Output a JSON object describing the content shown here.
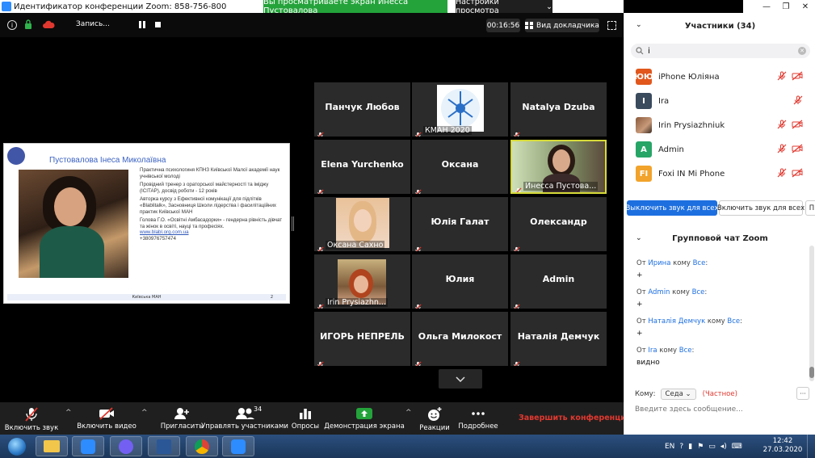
{
  "window": {
    "title": "Идентификатор конференции Zoom: 858-756-800",
    "viewing_banner": "Вы просматриваете экран Инесса Пустовалова",
    "view_settings": "Настройки просмотра"
  },
  "status_bar": {
    "recording_label": "Запись...",
    "timer": "00:16:56",
    "speaker_view": "Вид докладчика"
  },
  "shared_slide": {
    "title": "Пустовалова Інеса Миколаївна",
    "paragraphs": [
      "Практична психологиня КПНЗ Київської Малої академії наук учнівської молоді",
      "Провідний тренер з ораторської майстерності та іміджу (ІСІТАР), досвід роботи - 12 років",
      "Авторка курсу з Ефективної комунікації для підлітків «Blablitalk», Засновниця Школи лідерства і фасилітаційних практик Київської МАН",
      "Голова Г.О. «Освітні Амбасадорки» - гендерна рівність дівчат та жінок в освіті, науці та професіях."
    ],
    "link": "www.blabl.org.com.ua",
    "phone": "+380976757474",
    "footer": "Київська МАН",
    "page_number": "2"
  },
  "grid": {
    "tiles": [
      {
        "name": "Панчук Любов",
        "label": "",
        "kind": "name"
      },
      {
        "name": "",
        "label": "КМАН 2020",
        "kind": "logo"
      },
      {
        "name": "Natalya  Dzuba",
        "label": "",
        "kind": "name"
      },
      {
        "name": "Elena Yurchenko",
        "label": "",
        "kind": "name"
      },
      {
        "name": "Оксана",
        "label": "",
        "kind": "name"
      },
      {
        "name": "",
        "label": "Инесса Пустова...",
        "kind": "video"
      },
      {
        "name": "",
        "label": "Оксана Сахно",
        "kind": "photo"
      },
      {
        "name": "Юлія Галат",
        "label": "",
        "kind": "name"
      },
      {
        "name": "Олександр",
        "label": "",
        "kind": "name"
      },
      {
        "name": "",
        "label": "Irin Prysiazhn...",
        "kind": "photo"
      },
      {
        "name": "Юлия",
        "label": "",
        "kind": "name"
      },
      {
        "name": "Admin",
        "label": "",
        "kind": "name"
      },
      {
        "name": "ИГОРЬ НЕПРЕЛЬ",
        "label": "",
        "kind": "name"
      },
      {
        "name": "Ольга Милокост",
        "label": "",
        "kind": "name"
      },
      {
        "name": "Наталія Демчук",
        "label": "",
        "kind": "name"
      }
    ]
  },
  "toolbar": {
    "unmute": "Включить звук",
    "start_video": "Включить видео",
    "invite": "Пригласить",
    "manage_participants": "Управлять участниками",
    "participant_count": "34",
    "polls": "Опросы",
    "share_screen": "Демонстрация экрана",
    "reactions": "Реакции",
    "more": "Подробнее",
    "end": "Завершить конференцию"
  },
  "participants_panel": {
    "title": "Участники (34)",
    "search_value": "i",
    "participants": [
      {
        "initials": "ЮЮ",
        "name": "iPhone Юліяна",
        "color": "#e1571c"
      },
      {
        "initials": "I",
        "name": "Ira",
        "color": "#3b4b5e"
      },
      {
        "initials": "",
        "name": "Irin Prysiazhniuk",
        "color": "#8a5a3c"
      },
      {
        "initials": "A",
        "name": "Admin",
        "color": "#27a567"
      },
      {
        "initials": "FI",
        "name": "Foxi IN Mi Phone",
        "color": "#f1a32b"
      }
    ],
    "mute_all": "Выключить звук для всех",
    "unmute_all": "Включить звук для всех",
    "more": "П"
  },
  "chat": {
    "title": "Групповой чат Zoom",
    "messages": [
      {
        "from_word": "От",
        "sender": "Ирина",
        "to_word": "кому",
        "to": "Все",
        "colon": ":",
        "text": "+"
      },
      {
        "from_word": "От",
        "sender": "Admin",
        "to_word": "кому",
        "to": "Все",
        "colon": ":",
        "text": "+"
      },
      {
        "from_word": "От",
        "sender": "Наталія Демчук",
        "to_word": "кому",
        "to": "Все",
        "colon": ":",
        "text": "+"
      },
      {
        "from_word": "От",
        "sender": "Ira",
        "to_word": "кому",
        "to": "Все",
        "colon": ":",
        "text": "видно"
      }
    ],
    "to_label": "Кому:",
    "to_value": "Седа",
    "private": "(Частное)",
    "input_placeholder": "Введите здесь сообщение..."
  },
  "taskbar": {
    "language": "EN",
    "time": "12:42",
    "date": "27.03.2020"
  },
  "colors": {
    "accent": "#1d6fe0",
    "banner_green": "#24a33b",
    "end_red": "#e0382f",
    "mute_red": "#e0382f"
  }
}
